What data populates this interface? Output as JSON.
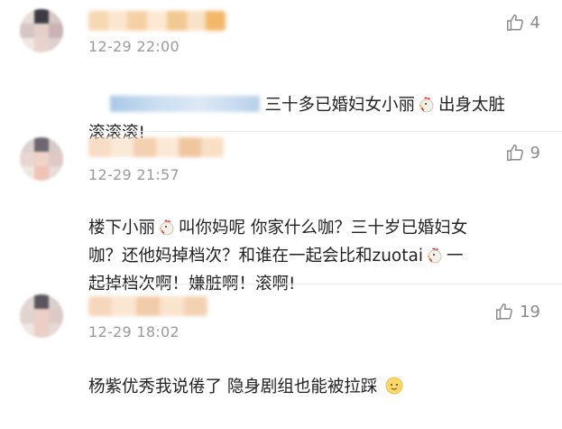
{
  "comments": [
    {
      "time": "12-29 22:00",
      "likes": "4",
      "line1_text": "三十多已婚妇女小丽",
      "line1_after": "出身太脏",
      "line2": "滚滚滚!"
    },
    {
      "time": "12-29 21:57",
      "likes": "9",
      "line1_a": "楼下小丽",
      "line1_b": "叫你妈呢 你家什么咖？三十岁已婚妇女",
      "line2_a": "咖？还他妈掉档次？和谁在一起会比和zuotai",
      "line2_b": "一",
      "line3": "起掉档次啊！嫌脏啊！滚啊!"
    },
    {
      "time": "12-29 18:02",
      "likes": "19",
      "line1": "杨紫优秀我说倦了 隐身剧组也能被拉踩"
    }
  ],
  "icons": {
    "like": "thumbs-up-icon",
    "chicken": "chicken-emoji-icon",
    "smile": "sweat-smile-emoji-icon"
  },
  "colors": {
    "time": "#9a9a9a",
    "text": "#222222",
    "icon": "#8a8a8a"
  }
}
